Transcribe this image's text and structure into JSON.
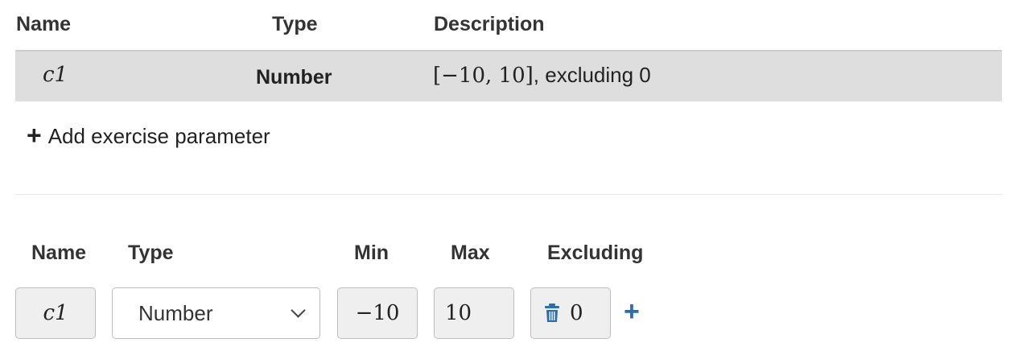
{
  "summary_table": {
    "headers": {
      "name": "Name",
      "type": "Type",
      "description": "Description"
    },
    "rows": [
      {
        "name": "c1",
        "type": "Number",
        "range": "[−10, 10]",
        "desc_suffix": ", excluding 0"
      }
    ]
  },
  "add_parameter_label": "Add exercise parameter",
  "editor": {
    "headers": {
      "name": "Name",
      "type": "Type",
      "min": "Min",
      "max": "Max",
      "excluding": "Excluding"
    },
    "name_value": "c1",
    "type_value": "Number",
    "min_value": "−10",
    "max_value": "10",
    "excluding_value": "0"
  },
  "icons": {
    "add_black": "plus-icon",
    "trash": "trash-icon",
    "add_blue": "plus-icon",
    "select": "chevron-down-icon"
  },
  "colors": {
    "row_bg": "#dedede",
    "accent_blue": "#2a6db0",
    "input_bg": "#efefef"
  }
}
